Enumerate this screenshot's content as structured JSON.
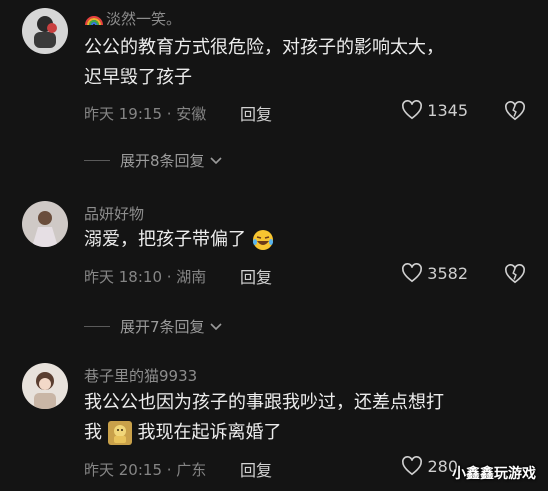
{
  "comments": [
    {
      "name": "淡然一笑。",
      "text_line1": "公公的教育方式很危险，对孩子的影响太大，",
      "text_line2": "迟早毁了孩子",
      "time": "昨天 19:15 · 安徽",
      "reply": "回复",
      "likes": "1345",
      "expand": "展开8条回复"
    },
    {
      "name": "品妍好物",
      "text": "溺爱，把孩子带偏了",
      "time": "昨天 18:10 · 湖南",
      "reply": "回复",
      "likes": "3582",
      "expand": "展开7条回复"
    },
    {
      "name": "巷子里的猫9933",
      "text_line1": "我公公也因为孩子的事跟我吵过，还差点想打",
      "text_line2_a": "我",
      "text_line2_b": "我现在起诉离婚了",
      "time": "昨天 20:15 · 广东",
      "reply": "回复",
      "likes": "280"
    }
  ],
  "watermark": "小鑫鑫玩游戏",
  "icons": {
    "rainbow": "rainbow-icon",
    "like": "heart-icon",
    "dislike": "broken-heart-icon",
    "chevron": "chevron-down-icon"
  }
}
